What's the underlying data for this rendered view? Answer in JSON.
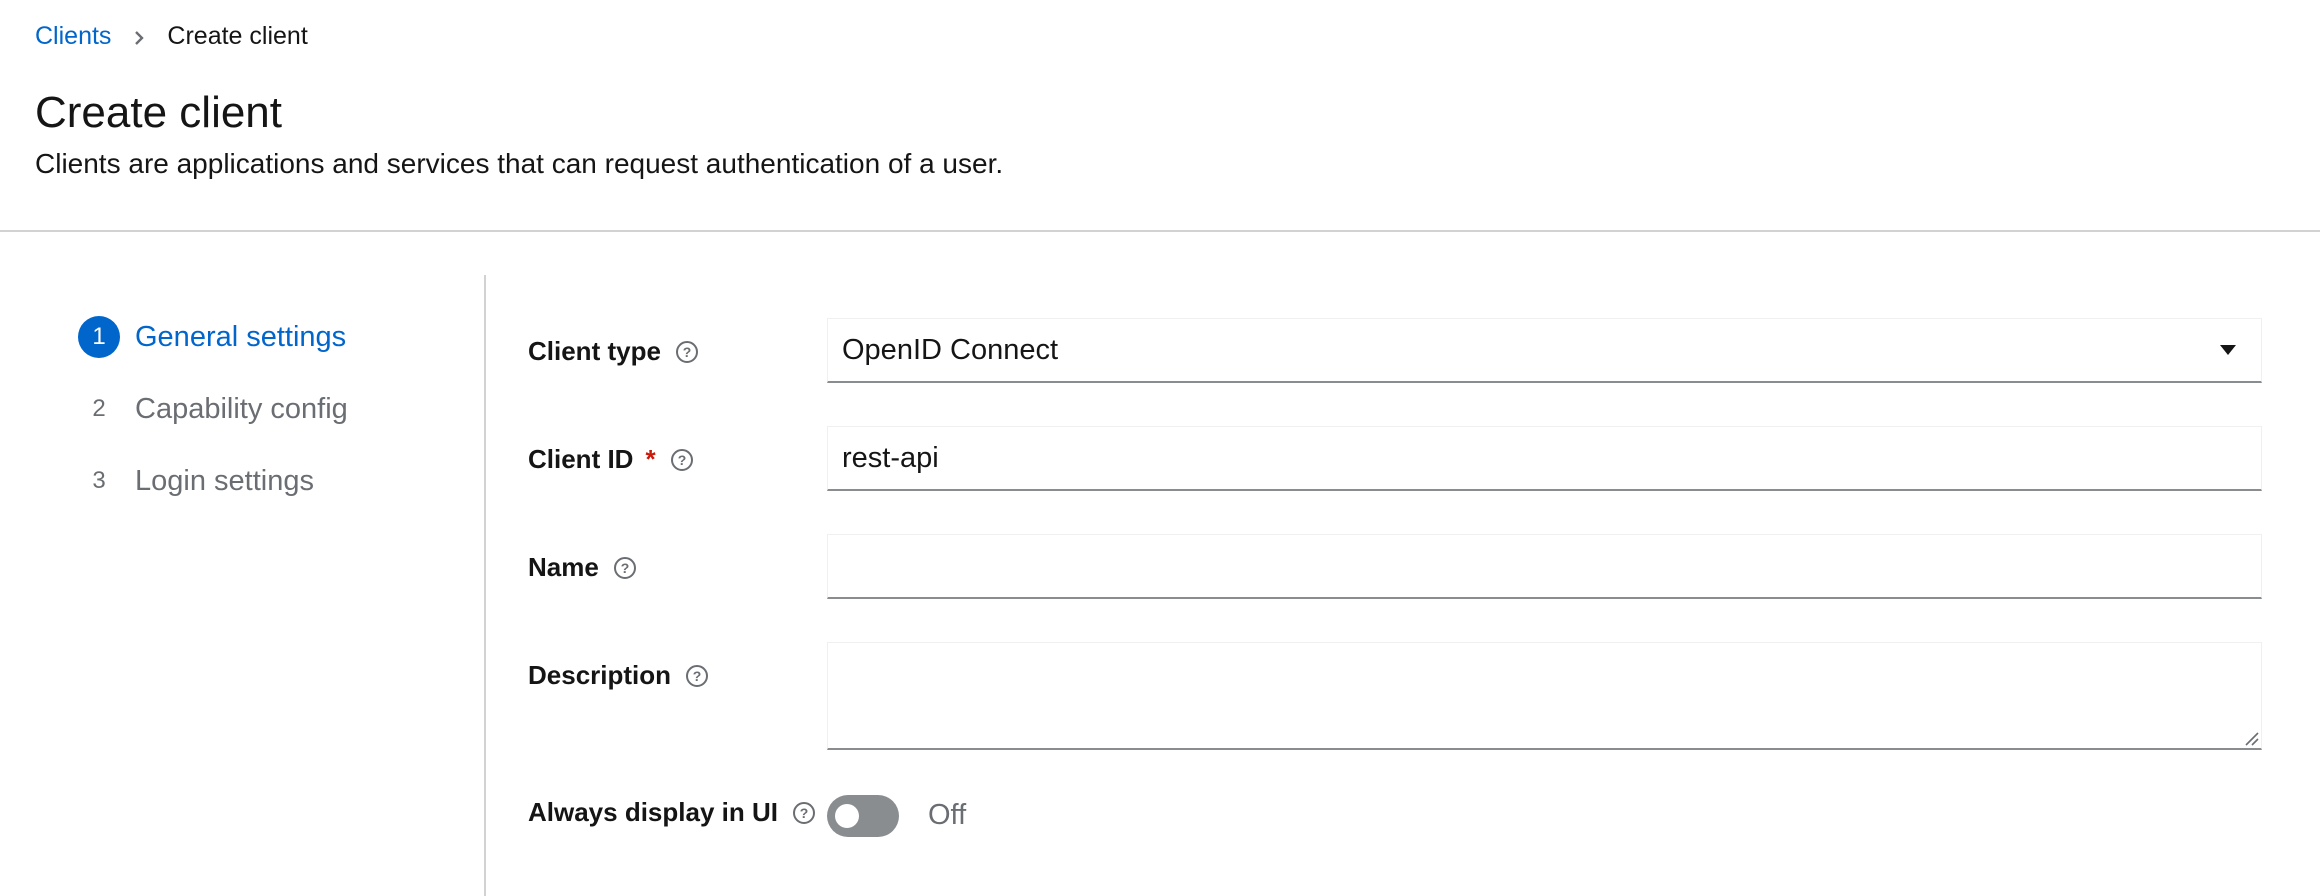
{
  "breadcrumb": {
    "parent": "Clients",
    "current": "Create client"
  },
  "header": {
    "title": "Create client",
    "description": "Clients are applications and services that can request authentication of a user."
  },
  "wizard": {
    "steps": [
      {
        "number": "1",
        "label": "General settings",
        "active": true
      },
      {
        "number": "2",
        "label": "Capability config",
        "active": false
      },
      {
        "number": "3",
        "label": "Login settings",
        "active": false
      }
    ]
  },
  "form": {
    "client_type": {
      "label": "Client type",
      "value": "OpenID Connect"
    },
    "client_id": {
      "label": "Client ID",
      "required_marker": "*",
      "value": "rest-api"
    },
    "name": {
      "label": "Name",
      "value": ""
    },
    "description": {
      "label": "Description",
      "value": ""
    },
    "always_display": {
      "label": "Always display in UI",
      "state_text": "Off",
      "on": false
    }
  },
  "colors": {
    "accent": "#0066cc",
    "required": "#c9190b",
    "muted": "#6a6e73",
    "border": "#8a8d90"
  }
}
